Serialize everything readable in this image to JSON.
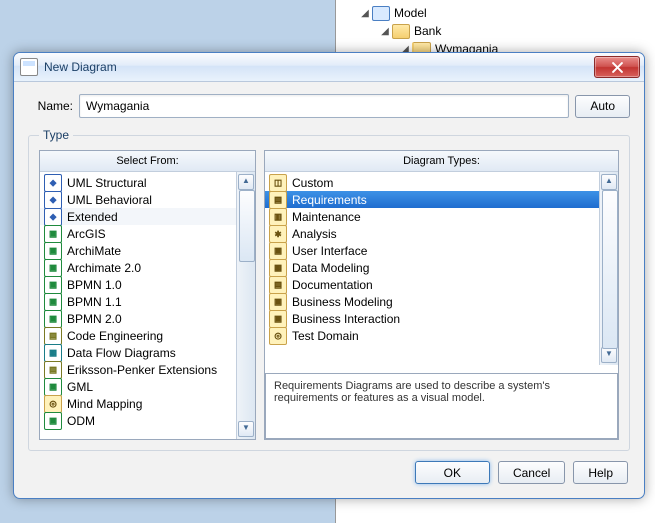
{
  "bg_tree": {
    "model": "Model",
    "bank": "Bank",
    "wymagania": "Wymagania"
  },
  "window": {
    "title": "New Diagram"
  },
  "form": {
    "name_label": "Name:",
    "name_value": "Wymagania",
    "auto_btn": "Auto",
    "type_legend": "Type"
  },
  "select_from": {
    "header": "Select From:",
    "items": [
      "UML Structural",
      "UML Behavioral",
      "Extended",
      "ArcGIS",
      "ArchiMate",
      "Archimate 2.0",
      "BPMN 1.0",
      "BPMN 1.1",
      "BPMN 2.0",
      "Code Engineering",
      "Data Flow Diagrams",
      "Eriksson-Penker Extensions",
      "GML",
      "Mind Mapping",
      "ODM"
    ],
    "selected_index": 2
  },
  "diagram_types": {
    "header": "Diagram Types:",
    "items": [
      "Custom",
      "Requirements",
      "Maintenance",
      "Analysis",
      "User Interface",
      "Data Modeling",
      "Documentation",
      "Business Modeling",
      "Business Interaction",
      "Test Domain"
    ],
    "selected_index": 1
  },
  "description": "Requirements Diagrams are used to describe a system's requirements or features as a visual model.",
  "buttons": {
    "ok": "OK",
    "cancel": "Cancel",
    "help": "Help"
  }
}
